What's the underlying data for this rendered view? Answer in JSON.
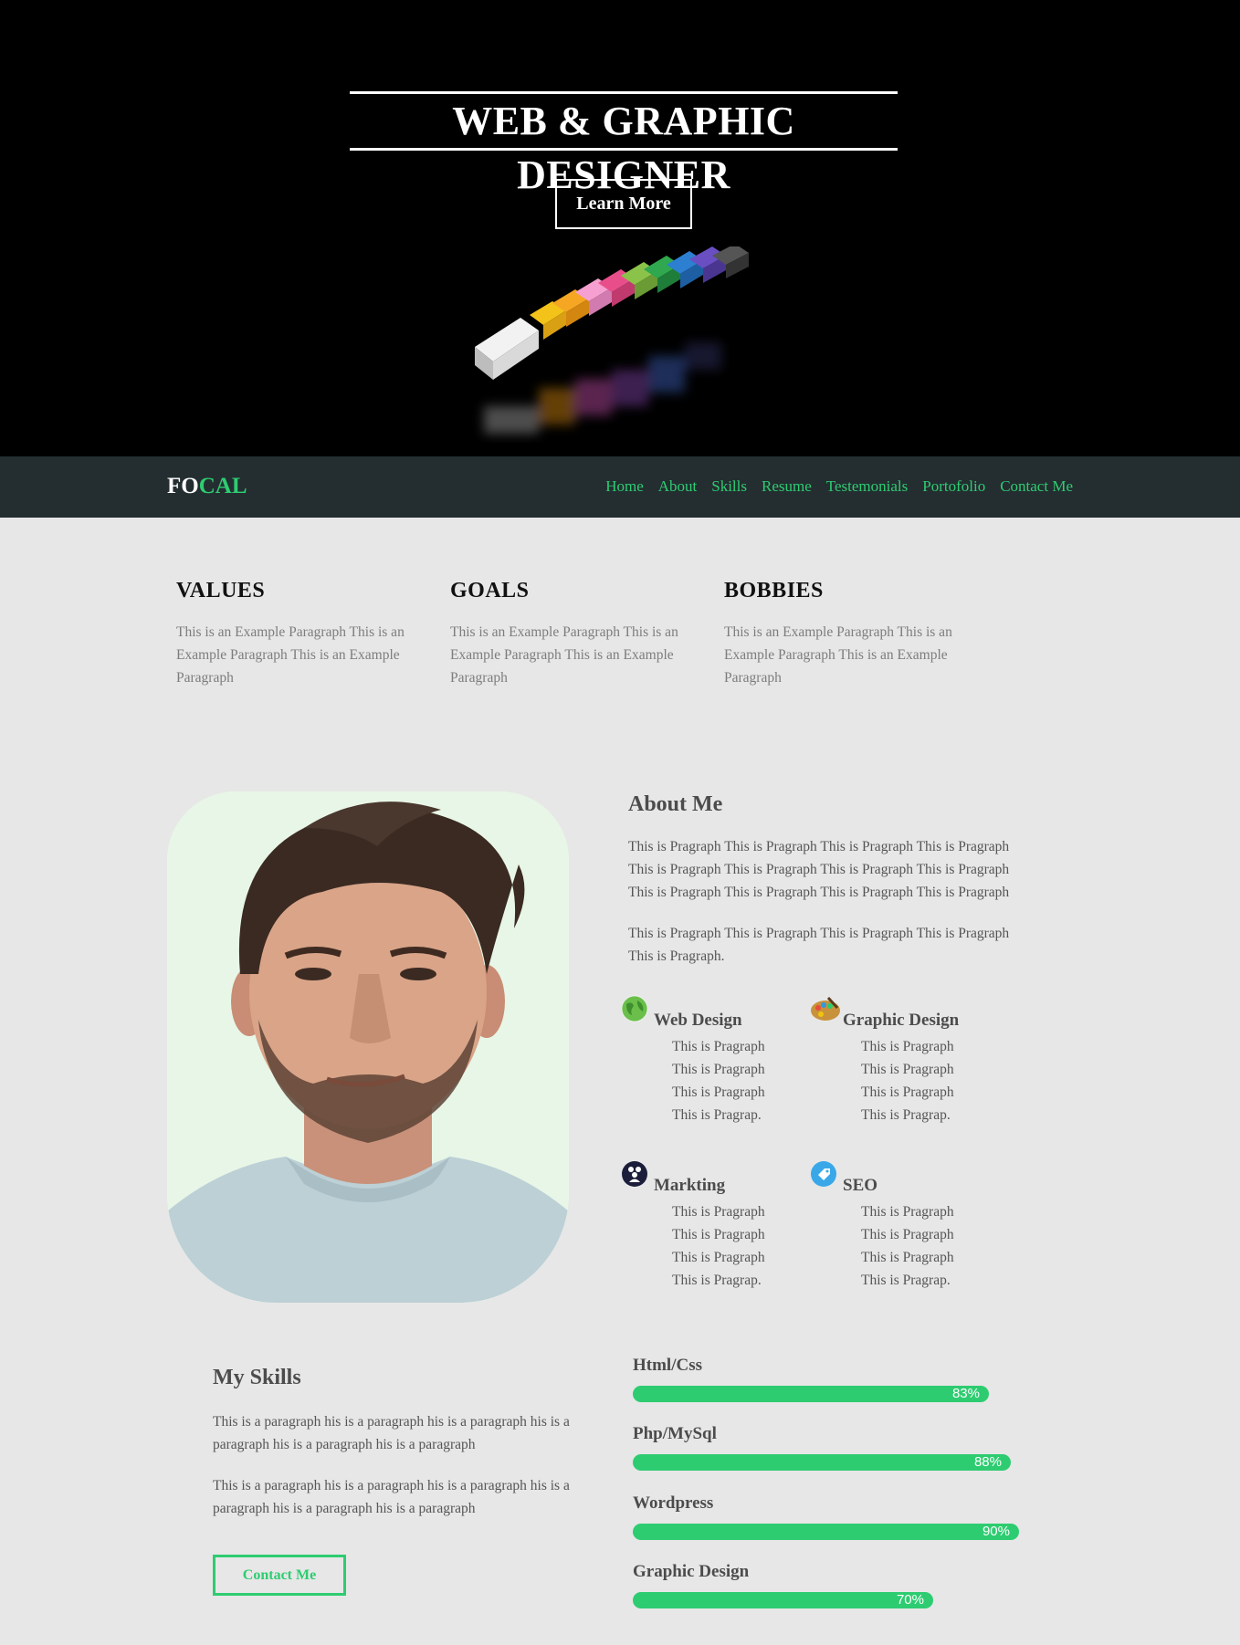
{
  "hero": {
    "title": "WEB & GRAPHIC DESIGNER",
    "button_label": "Learn More"
  },
  "nav": {
    "logo_part1": "FO",
    "logo_part2": "CAL",
    "links": [
      "Home",
      "About",
      "Skills",
      "Resume",
      "Testemonials",
      "Portofolio",
      "Contact Me"
    ]
  },
  "values": [
    {
      "title": "VALUES",
      "text": "This is an Example Paragraph This is an Example Paragraph This is an Example Paragraph"
    },
    {
      "title": "GOALS",
      "text": "This is an Example Paragraph This is an Example Paragraph This is an Example Paragraph"
    },
    {
      "title": "BOBBIES",
      "text": "This is an Example Paragraph This is an Example Paragraph This is an Example Paragraph"
    }
  ],
  "about": {
    "title": "About Me",
    "p1": "This is Pragraph This is Pragraph This is Pragraph This is Pragraph This is Pragraph This is Pragraph This is Pragraph This is Pragraph This is Pragraph This is Pragraph This is Pragraph This is Pragraph",
    "p2": "This is Pragraph This is Pragraph This is Pragraph This is Pragraph This is Pragraph.",
    "services": [
      {
        "title": "Web Design",
        "icon": "globe-icon",
        "lines": [
          "This is Pragraph",
          "This is Pragraph",
          "This is Pragraph",
          "This is Pragrap."
        ]
      },
      {
        "title": "Graphic Design",
        "icon": "palette-icon",
        "lines": [
          "This is Pragraph",
          "This is Pragraph",
          "This is Pragraph",
          "This is Pragrap."
        ]
      },
      {
        "title": "Markting",
        "icon": "marketing-icon",
        "lines": [
          "This is Pragraph",
          "This is Pragraph",
          "This is Pragraph",
          "This is Pragrap."
        ]
      },
      {
        "title": "SEO",
        "icon": "seo-tag-icon",
        "lines": [
          "This is Pragraph",
          "This is Pragraph",
          "This is Pragraph",
          "This is Pragrap."
        ]
      }
    ]
  },
  "skills": {
    "title": "My Skills",
    "p1": "This is a paragraph his is a paragraph his is a paragraph his is a paragraph his is a paragraph his is a paragraph",
    "p2": "This is a paragraph his is a paragraph his is a paragraph his is a paragraph his is a paragraph his is a paragraph",
    "contact_label": "Contact Me",
    "bars": [
      {
        "label": "Html/Css",
        "percent_text": "83%",
        "value": 83
      },
      {
        "label": "Php/MySql",
        "percent_text": "88%",
        "value": 88
      },
      {
        "label": "Wordpress",
        "percent_text": "90%",
        "value": 90
      },
      {
        "label": "Graphic Design",
        "percent_text": "70%",
        "value": 70
      }
    ]
  },
  "colors": {
    "accent": "#2ecc71",
    "nav_bg": "#242e31",
    "page_bg": "#e7e7e7",
    "hero_bg": "#000000"
  }
}
